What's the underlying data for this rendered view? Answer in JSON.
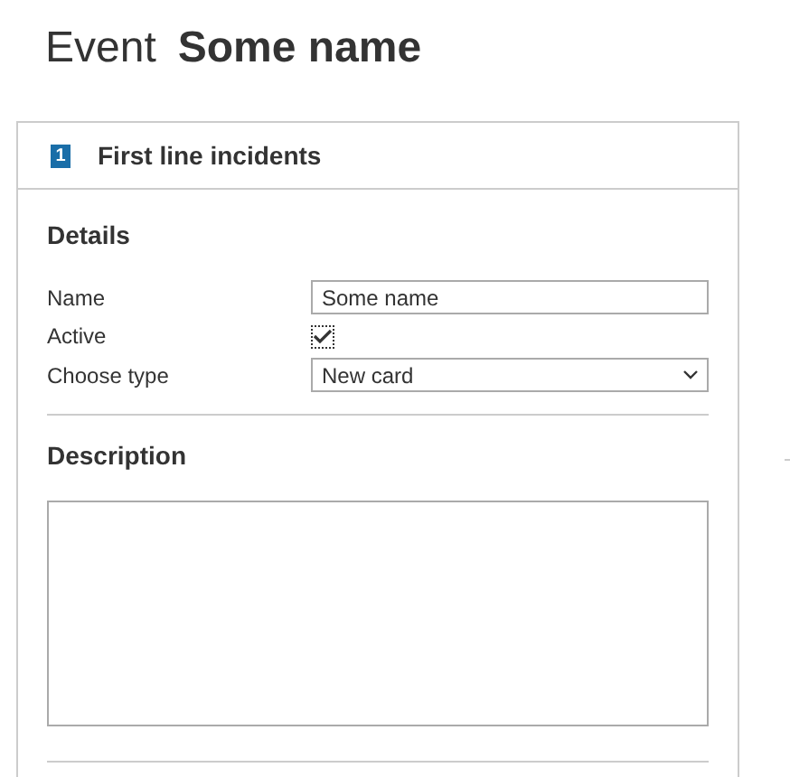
{
  "page": {
    "title_prefix": "Event",
    "title_name": "Some name"
  },
  "panel": {
    "header": "First line incidents",
    "badge": "1"
  },
  "details": {
    "heading": "Details",
    "fields": [
      {
        "kind": "text",
        "label": "Name",
        "value": "Some name"
      },
      {
        "kind": "checkbox",
        "label": "Active",
        "checked": true
      },
      {
        "kind": "select",
        "label": "Choose type",
        "value": "New card"
      }
    ]
  },
  "description": {
    "heading": "Description"
  }
}
